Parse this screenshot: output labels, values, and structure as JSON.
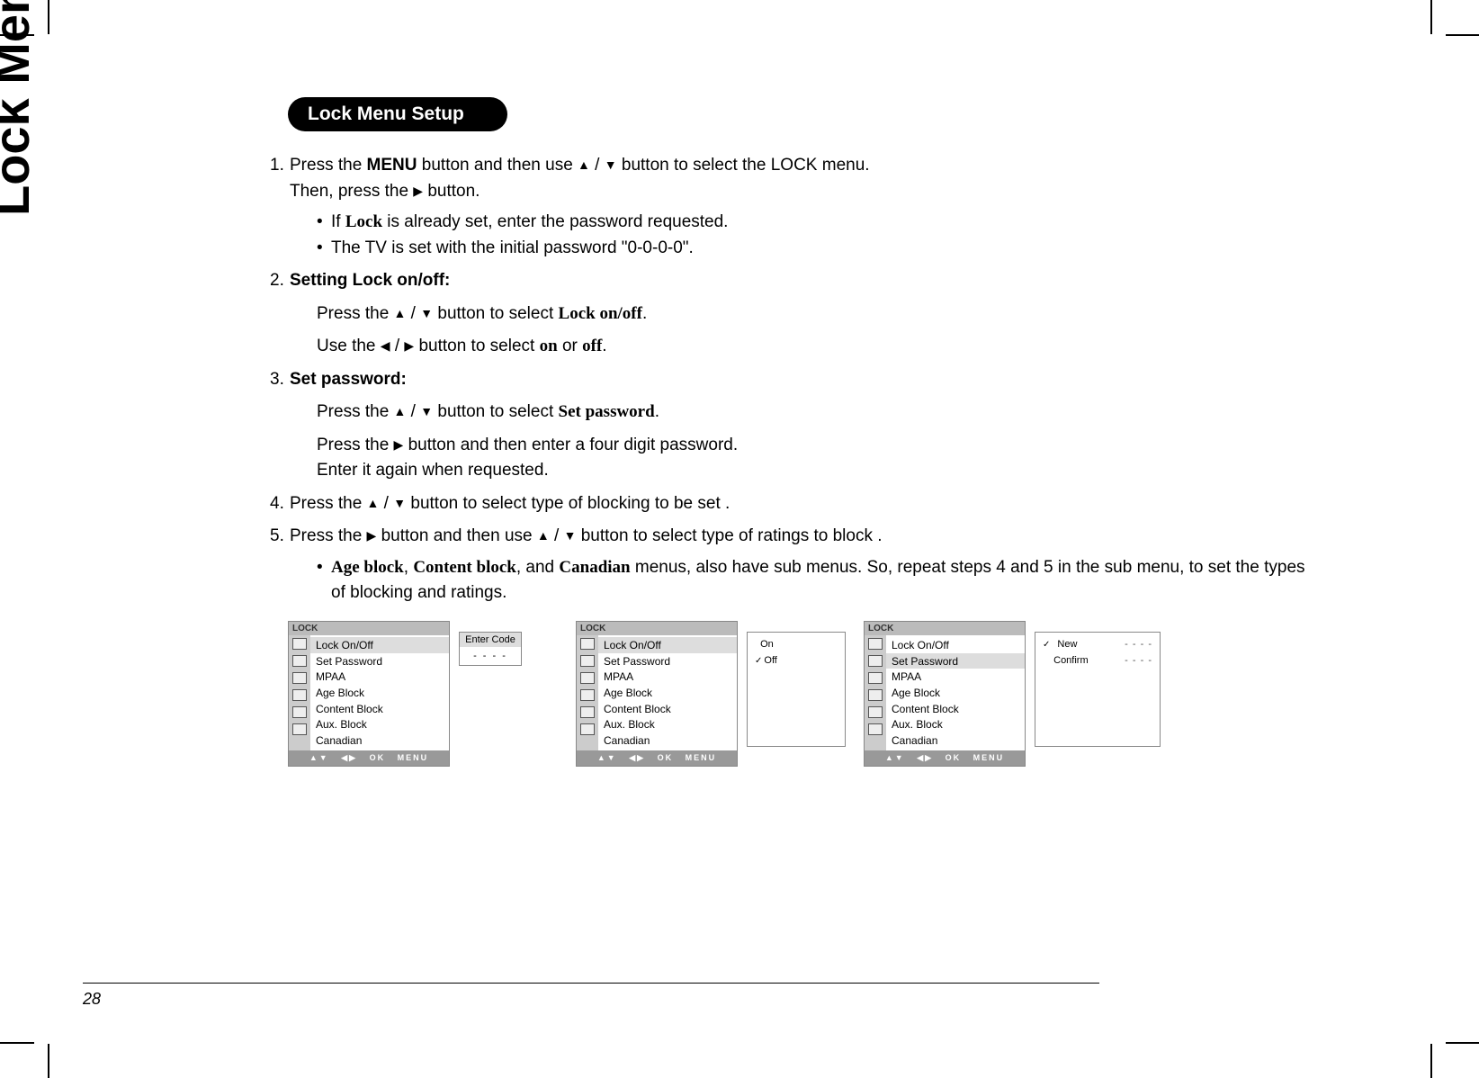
{
  "page": {
    "side_title": "Lock Menu",
    "number": "28"
  },
  "heading": "Lock Menu Setup",
  "steps": {
    "s1": {
      "num": "1.",
      "pre": "Press the ",
      "menu": "MENU",
      "mid": " button and then use ",
      "up": "▲",
      "slash": " / ",
      "down": "▼",
      "post": " button to select the LOCK menu.",
      "line2a": "Then, press the ",
      "right": "▶",
      "line2b": " button.",
      "b1a": "If ",
      "b1lock": "Lock",
      "b1b": " is already set, enter the password requested.",
      "b2": "The TV is set with the initial password \"0-0-0-0\"."
    },
    "s2": {
      "num": "2.",
      "title": "Setting Lock on/off:",
      "l1a": "Press the ",
      "up": "▲",
      "slash": " / ",
      "down": "▼",
      "l1b": " button to select ",
      "bold1": "Lock on/off",
      "l1c": ".",
      "l2a": "Use the ",
      "left": "◀",
      "slash2": " / ",
      "right": "▶",
      "l2b": " button to select ",
      "on": "on",
      "or": " or ",
      "off": "off",
      "l2c": "."
    },
    "s3": {
      "num": "3.",
      "title": "Set password:",
      "l1a": "Press the ",
      "up": "▲",
      "slash": " / ",
      "down": "▼",
      "l1b": " button to select ",
      "bold1": "Set password",
      "l1c": ".",
      "l2a": "Press the ",
      "right": "▶",
      "l2b": " button and then enter a four digit password.",
      "l3": "Enter it again when requested."
    },
    "s4": {
      "num": "4.",
      "a": "Press the ",
      "up": "▲",
      "slash": " / ",
      "down": "▼",
      "b": " button to select type of blocking to be set ."
    },
    "s5": {
      "num": "5.",
      "a": "Press the ",
      "right": "▶",
      "b": " button and then use ",
      "up": "▲",
      "slash": " / ",
      "down": "▼",
      "c": " button to select type of ratings to block .",
      "bul_age": "Age block",
      "bul_sep1": ", ",
      "bul_content": "Content block",
      "bul_sep2": ", and ",
      "bul_can": "Canadian",
      "bul_rest": " menus, also have sub menus. So, repeat steps 4 and 5 in the sub menu, to set the types of blocking and ratings."
    }
  },
  "menu": {
    "title": "LOCK",
    "items": [
      "Lock On/Off",
      "Set Password",
      "MPAA",
      "Age Block",
      "Content Block",
      "Aux. Block",
      "Canadian"
    ],
    "footer_updown": "▲▼",
    "footer_leftright": "◀▶",
    "footer_ok": "OK",
    "footer_menu": "MENU"
  },
  "screen1": {
    "enter_label": "Enter Code",
    "dashes": "- - - -"
  },
  "screen2": {
    "opt_on": "On",
    "opt_off": "Off"
  },
  "screen3": {
    "new": "New",
    "confirm": "Confirm",
    "dashes": "- - - -"
  }
}
